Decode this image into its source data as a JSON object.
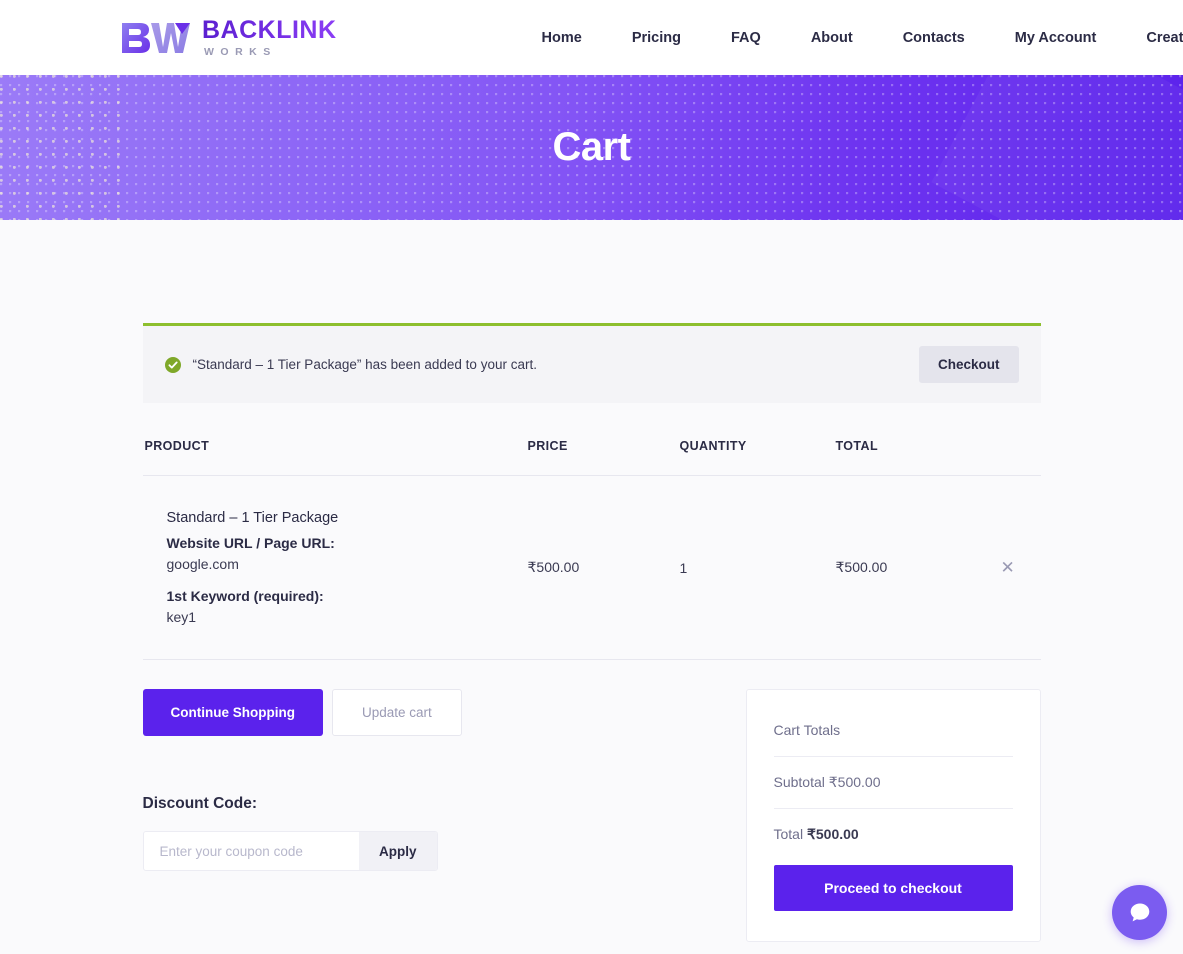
{
  "header": {
    "logo": {
      "mark_icon": "bw-monogram-icon",
      "title": "BACKLINK",
      "subtitle": "WORKS"
    },
    "nav": [
      {
        "label": "Home"
      },
      {
        "label": "Pricing"
      },
      {
        "label": "FAQ"
      },
      {
        "label": "About"
      },
      {
        "label": "Contacts"
      },
      {
        "label": "My Account"
      },
      {
        "label": "Create Account"
      }
    ]
  },
  "hero": {
    "title": "Cart"
  },
  "notice": {
    "icon": "check-circle-icon",
    "message": "“Standard – 1 Tier Package” has been added to your cart.",
    "checkout_label": "Checkout"
  },
  "cart_table": {
    "headers": {
      "product": "PRODUCT",
      "price": "PRICE",
      "quantity": "QUANTITY",
      "total": "TOTAL"
    },
    "rows": [
      {
        "name": "Standard – 1 Tier Package",
        "meta": [
          {
            "label": "Website URL / Page URL:",
            "value": "google.com"
          },
          {
            "label": "1st Keyword (required):",
            "value": "key1"
          }
        ],
        "price": "₹500.00",
        "quantity": "1",
        "total": "₹500.00",
        "remove_icon": "close-x-icon"
      }
    ]
  },
  "actions": {
    "continue_label": "Continue Shopping",
    "update_label": "Update cart"
  },
  "discount": {
    "title": "Discount Code:",
    "placeholder": "Enter your coupon code",
    "value": "",
    "apply_label": "Apply"
  },
  "totals": {
    "heading": "Cart Totals",
    "subtotal_label": "Subtotal",
    "subtotal_value": "₹500.00",
    "total_label": "Total",
    "total_value": "₹500.00",
    "proceed_label": "Proceed to checkout"
  },
  "chat": {
    "icon": "chat-bubble-icon"
  },
  "colors": {
    "brand_purple": "#5b22ec",
    "notice_green": "#8dbf2e",
    "page_bg": "#fafafc"
  }
}
